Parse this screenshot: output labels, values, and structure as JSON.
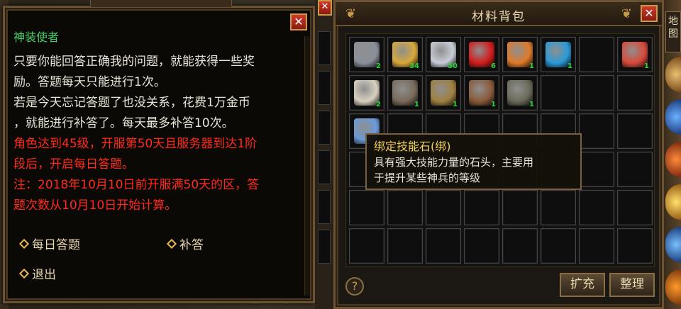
{
  "npc": {
    "close_label": "✕",
    "title": "神装使者",
    "lines": [
      "只要你能回答正确我的问题，就能获得一些奖",
      "励。答题每天只能进行1次。",
      "若是今天忘记答题了也没关系，花费1万金币",
      "，就能进行补答了。每天最多补答10次。"
    ],
    "red_lines": [
      "角色达到45级，开服第50天且服务器到达1阶",
      "段后，开启每日答题。",
      "注：2018年10月10日前开服满50天的区，答",
      "题次数从10月10日开始计算。"
    ],
    "options": {
      "daily_quiz": "每日答题",
      "makeup": "补答",
      "exit": "退出"
    }
  },
  "bag": {
    "title": "材料背包",
    "close_label": "✕",
    "items": [
      {
        "name": "ore",
        "qty": "2",
        "color": "#8a8f99"
      },
      {
        "name": "gold-scroll",
        "qty": "34",
        "color": "#d8a83a"
      },
      {
        "name": "feather",
        "qty": "50",
        "color": "#c8ccd6"
      },
      {
        "name": "red-orb",
        "qty": "6",
        "color": "#d11c1c"
      },
      {
        "name": "orange-crystal",
        "qty": "1",
        "color": "#e07a2a"
      },
      {
        "name": "blue-crystal",
        "qty": "1",
        "color": "#2a9ad8"
      },
      {
        "name": "gift-box",
        "qty": "1",
        "color": "#d84a3a"
      },
      {
        "name": "white-mount",
        "qty": "2",
        "color": "#d8d0c0"
      },
      {
        "name": "bat",
        "qty": "1",
        "color": "#7a6a5a"
      },
      {
        "name": "chain",
        "qty": "1",
        "color": "#a08040"
      },
      {
        "name": "spider",
        "qty": "1",
        "color": "#8a5a3a"
      },
      {
        "name": "warrior",
        "qty": "1",
        "color": "#6a6a5a"
      },
      {
        "name": "skill-stone",
        "qty": "",
        "color": "#6a9ad8"
      }
    ],
    "buttons": {
      "expand": "扩充",
      "sort": "整理"
    },
    "help_label": "?"
  },
  "tooltip": {
    "title": "绑定技能石(绑)",
    "desc_lines": [
      "具有强大技能力量的石头，主要用",
      "于提升某些神兵的等级"
    ]
  },
  "side": {
    "map_label": "地图"
  }
}
